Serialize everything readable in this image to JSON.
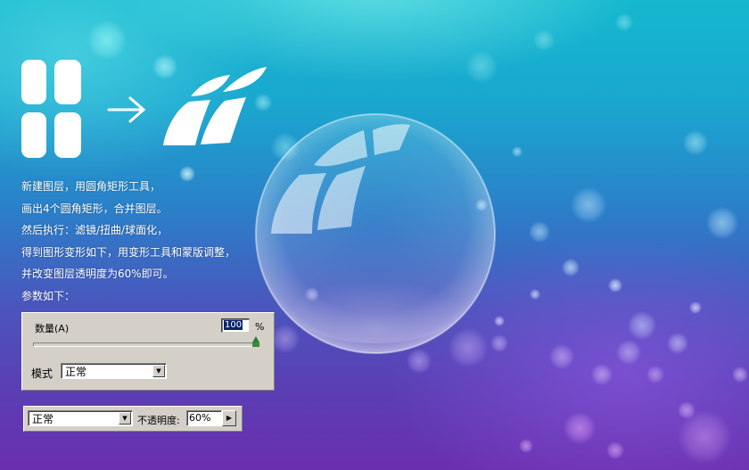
{
  "tutorial": {
    "lines": [
      "新建图层，用圆角矩形工具，",
      "画出4个圆角矩形，合并图层。",
      "然后执行：滤镜/扭曲/球面化，",
      "得到图形变形如下，用变形工具和蒙版调整，",
      "并改变图层透明度为60%即可。",
      "参数如下："
    ]
  },
  "spherize_panel": {
    "amount_label": "数量(A)",
    "amount_value": "100",
    "amount_fraction": 1.0,
    "percent_sign": "%",
    "mode_label": "模式",
    "mode_value": "正常"
  },
  "layers_bar": {
    "blend_mode": "正常",
    "opacity_label": "不透明度:",
    "opacity_value": "60%"
  },
  "colors": {
    "accent_thumb": "#2e7d32",
    "selection": "#0a246a"
  }
}
